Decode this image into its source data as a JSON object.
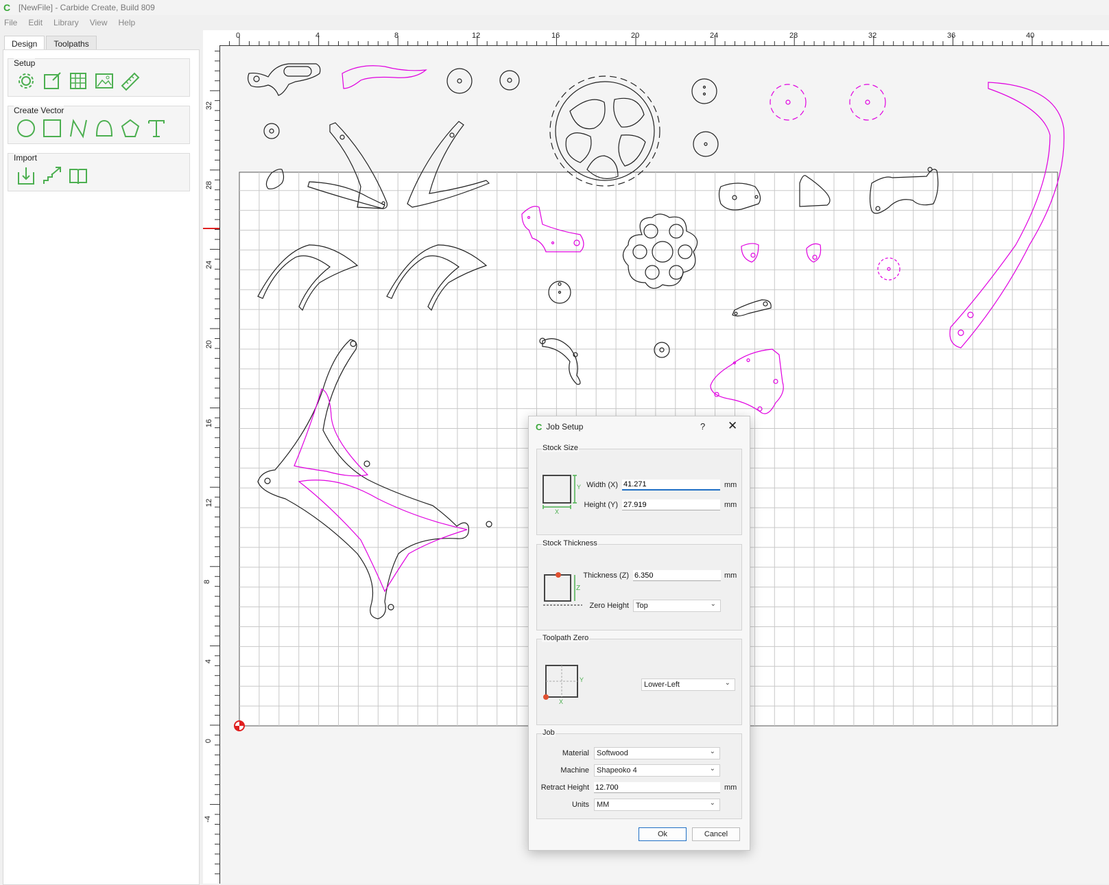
{
  "window": {
    "title": "[NewFile] - Carbide Create, Build 809"
  },
  "menu": [
    "File",
    "Edit",
    "Library",
    "View",
    "Help"
  ],
  "tabs": [
    "Design",
    "Toolpaths"
  ],
  "groups": {
    "setup": "Setup",
    "create_vector": "Create Vector",
    "import": "Import"
  },
  "icons": {
    "setup": [
      "gear-icon",
      "edit-document-icon",
      "grid-icon",
      "image-icon",
      "ruler-icon"
    ],
    "create_vector": [
      "circle-icon",
      "rectangle-icon",
      "polyline-icon",
      "curve-icon",
      "polygon-icon",
      "text-icon"
    ],
    "import": [
      "import-file-icon",
      "import-stairs-icon",
      "library-book-icon"
    ]
  },
  "ruler": {
    "x": [
      "0",
      "4",
      "8",
      "12",
      "16",
      "20",
      "24",
      "28",
      "32",
      "36",
      "40"
    ],
    "y": [
      "32",
      "28",
      "24",
      "20",
      "16",
      "12",
      "8",
      "4",
      "0",
      "-4"
    ]
  },
  "colors": {
    "accent": "#3aa83a",
    "selected_vector": "#e000e0",
    "vector": "#222222",
    "focus": "#1f6fc5"
  },
  "dialog": {
    "title": "Job Setup",
    "help": "?",
    "close": "✕",
    "stock_size": {
      "title": "Stock Size",
      "width_label": "Width (X)",
      "width_value": "41.271",
      "height_label": "Height (Y)",
      "height_value": "27.919",
      "unit": "mm"
    },
    "stock_thickness": {
      "title": "Stock Thickness",
      "thickness_label": "Thickness (Z)",
      "thickness_value": "6.350",
      "unit": "mm",
      "zero_height_label": "Zero Height",
      "zero_height_value": "Top"
    },
    "toolpath_zero": {
      "title": "Toolpath Zero",
      "value": "Lower-Left"
    },
    "job": {
      "title": "Job",
      "material_label": "Material",
      "material_value": "Softwood",
      "machine_label": "Machine",
      "machine_value": "Shapeoko 4",
      "retract_label": "Retract Height",
      "retract_value": "12.700",
      "retract_unit": "mm",
      "units_label": "Units",
      "units_value": "MM"
    },
    "ok": "Ok",
    "cancel": "Cancel"
  }
}
